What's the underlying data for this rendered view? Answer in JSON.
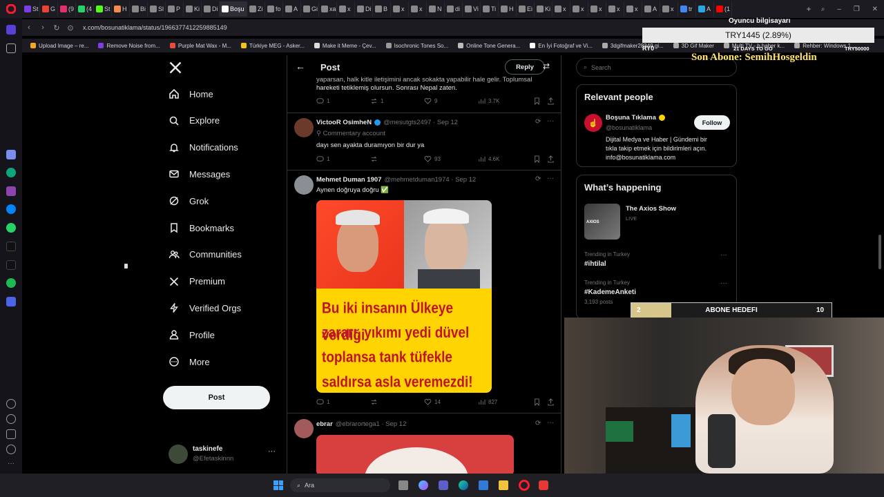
{
  "browser": {
    "tabs": [
      {
        "label": "St",
        "color": "#7b3fe4"
      },
      {
        "label": "G",
        "color": "#ea4335"
      },
      {
        "label": "(9",
        "color": "#e1306c"
      },
      {
        "label": "(4",
        "color": "#25d366"
      },
      {
        "label": "St",
        "color": "#53fc18"
      },
      {
        "label": "H",
        "color": "#f28b4b"
      },
      {
        "label": "Bi",
        "color": "#888"
      },
      {
        "label": "Sl",
        "color": "#888"
      },
      {
        "label": "P",
        "color": "#888"
      },
      {
        "label": "Ki",
        "color": "#888"
      },
      {
        "label": "Di",
        "color": "#888"
      },
      {
        "label": "Boşu",
        "color": "#fff",
        "active": true
      },
      {
        "label": "Zi",
        "color": "#888"
      },
      {
        "label": "fo",
        "color": "#888"
      },
      {
        "label": "A",
        "color": "#888"
      },
      {
        "label": "Gi",
        "color": "#888"
      },
      {
        "label": "xa",
        "color": "#888"
      },
      {
        "label": "x",
        "color": "#888"
      },
      {
        "label": "Di",
        "color": "#888"
      },
      {
        "label": "B",
        "color": "#888"
      },
      {
        "label": "x",
        "color": "#888"
      },
      {
        "label": "x",
        "color": "#888"
      },
      {
        "label": "N",
        "color": "#888"
      },
      {
        "label": "di",
        "color": "#888"
      },
      {
        "label": "Vi",
        "color": "#888"
      },
      {
        "label": "Ti",
        "color": "#888"
      },
      {
        "label": "H",
        "color": "#888"
      },
      {
        "label": "Ei",
        "color": "#888"
      },
      {
        "label": "Ki",
        "color": "#888"
      },
      {
        "label": "x",
        "color": "#888"
      },
      {
        "label": "x",
        "color": "#888"
      },
      {
        "label": "x",
        "color": "#888"
      },
      {
        "label": "x",
        "color": "#888"
      },
      {
        "label": "x",
        "color": "#888"
      },
      {
        "label": "A",
        "color": "#888"
      },
      {
        "label": "x",
        "color": "#888"
      },
      {
        "label": "tr",
        "color": "#4285f4"
      },
      {
        "label": "A",
        "color": "#2aa7e0"
      },
      {
        "label": "(1",
        "color": "#ff0000"
      }
    ],
    "url": "x.com/bosunatiklama/status/1966377412259885149",
    "bookmarks": [
      {
        "label": "Upload Image – re...",
        "color": "#f5a623"
      },
      {
        "label": "Remove Noise from...",
        "color": "#7b3fe4"
      },
      {
        "label": "Purple Mat Wax - M...",
        "color": "#e74c3c"
      },
      {
        "label": "Türkiye MEG - Asker...",
        "color": "#f1c40f"
      },
      {
        "label": "Make it Meme - Çev...",
        "color": "#ddd"
      },
      {
        "label": "Isochronic Tones So...",
        "color": "#999"
      },
      {
        "label": "Online Tone Genera...",
        "color": "#bbb"
      },
      {
        "label": "En İyi Fotoğraf ve Vi...",
        "color": "#fff"
      },
      {
        "label": "3dgifmaker28349.gi...",
        "color": "#aaa"
      },
      {
        "label": "3D Gif Maker",
        "color": "#aaa"
      },
      {
        "label": "Multi TV - b haber k...",
        "color": "#aaa"
      },
      {
        "label": "Rehber: Windows 1...",
        "color": "#aaa"
      }
    ]
  },
  "nav": {
    "items": [
      {
        "label": "Home",
        "icon": "home-icon"
      },
      {
        "label": "Explore",
        "icon": "search-icon"
      },
      {
        "label": "Notifications",
        "icon": "bell-icon"
      },
      {
        "label": "Messages",
        "icon": "envelope-icon"
      },
      {
        "label": "Grok",
        "icon": "grok-icon"
      },
      {
        "label": "Bookmarks",
        "icon": "bookmark-icon"
      },
      {
        "label": "Communities",
        "icon": "people-icon"
      },
      {
        "label": "Premium",
        "icon": "x-logo-icon"
      },
      {
        "label": "Verified Orgs",
        "icon": "lightning-icon"
      },
      {
        "label": "Profile",
        "icon": "person-icon"
      },
      {
        "label": "More",
        "icon": "more-circle-icon"
      }
    ],
    "post_label": "Post",
    "profile": {
      "name": "taskinefe",
      "handle": "@Efetaskinnn"
    }
  },
  "feed": {
    "header_title": "Post",
    "reply_label": "Reply",
    "top_text_line1": "yaparsan, halk kitle iletişimini ancak sokakta yapabilir hale gelir. Toplumsal",
    "top_text_line2": "hareketi tetiklemiş olursun. Sonrası Nepal zaten.",
    "top_stats": {
      "replies": "1",
      "reposts": "1",
      "likes": "9",
      "views": "3.7K"
    },
    "tweets": [
      {
        "name": "VictooR OsimheN",
        "handle": "@mesutgts2497 · Sep 12",
        "badge": "Commentary account",
        "text": "dayı  sen ayakta duramıyon bir dur ya",
        "replies": "1",
        "reposts": "",
        "likes": "93",
        "views": "4.6K"
      },
      {
        "name": "Mehmet Duman 1907",
        "handle": "@mehmetduman1974 · Sep 12",
        "text": "Aynen doğruya doğru ✅",
        "image_text": [
          "Bu iki insanın Ülkeye verdiği",
          "zararı, yıkımı yedi düvel",
          "toplansa tank tüfekle",
          "saldırsa asla veremezdi!"
        ],
        "replies": "1",
        "reposts": "",
        "likes": "14",
        "views": "827"
      },
      {
        "name": "ebrar",
        "handle": "@ebrarortega1 · Sep 12"
      }
    ]
  },
  "sidebar": {
    "search_placeholder": "Search",
    "relevant_title": "Relevant people",
    "person": {
      "name": "Boşuna Tıklama",
      "handle": "@bosunatiklama",
      "follow_label": "Follow",
      "bio": [
        "Dijital Medya ve Haber | Gündemi bir",
        "tıkla takip etmek için bildirimleri açın.",
        "info@bosunatiklama.com"
      ]
    },
    "happening_title": "What’s happening",
    "show": {
      "title": "The Axios Show",
      "status": "LIVE"
    },
    "trends": [
      {
        "context": "Trending in Turkey",
        "tag": "#ihtilal",
        "posts": ""
      },
      {
        "context": "Trending in Turkey",
        "tag": "#KademeAnketi",
        "posts": "3,193 posts"
      }
    ]
  },
  "overlay": {
    "pc_label": "Oyuncu bilgisayarı",
    "price": "TRY1445 (2.89%)",
    "left_val": "RY0",
    "days": "21 DAYS TO GO",
    "right_val": "TRY50000",
    "sub_text": "Son Abone: SemihHosgeldin",
    "goal_current": "2",
    "goal_label": "ABONE HEDEFI",
    "goal_target": "10",
    "goal_progress": 0.2
  },
  "taskbar": {
    "search_label": "Ara"
  },
  "colors": {
    "accent": "#1d9bf0",
    "gold": "#ffd400",
    "bg": "#000000",
    "border": "#2f3336"
  }
}
